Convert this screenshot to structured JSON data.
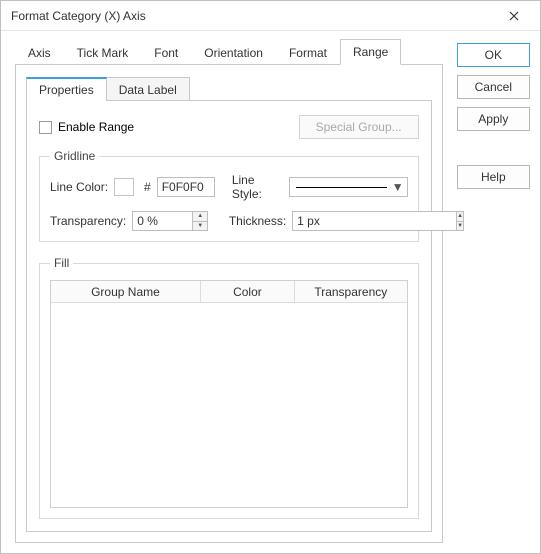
{
  "title": "Format Category (X) Axis",
  "tabs": [
    "Axis",
    "Tick Mark",
    "Font",
    "Orientation",
    "Format",
    "Range"
  ],
  "activeTab": "Range",
  "innerTabs": [
    "Properties",
    "Data Label"
  ],
  "activeInnerTab": "Properties",
  "enableRange": {
    "label": "Enable Range",
    "checked": false
  },
  "specialGroup": "Special Group...",
  "gridline": {
    "legend": "Gridline",
    "lineColorLabel": "Line Color:",
    "hash": "#",
    "lineColorHex": "F0F0F0",
    "lineStyleLabel": "Line Style:",
    "transparencyLabel": "Transparency:",
    "transparencyValue": "0 %",
    "thicknessLabel": "Thickness:",
    "thicknessValue": "1 px"
  },
  "fill": {
    "legend": "Fill",
    "headers": {
      "group": "Group Name",
      "color": "Color",
      "transparency": "Transparency"
    }
  },
  "buttons": {
    "ok": "OK",
    "cancel": "Cancel",
    "apply": "Apply",
    "help": "Help"
  }
}
